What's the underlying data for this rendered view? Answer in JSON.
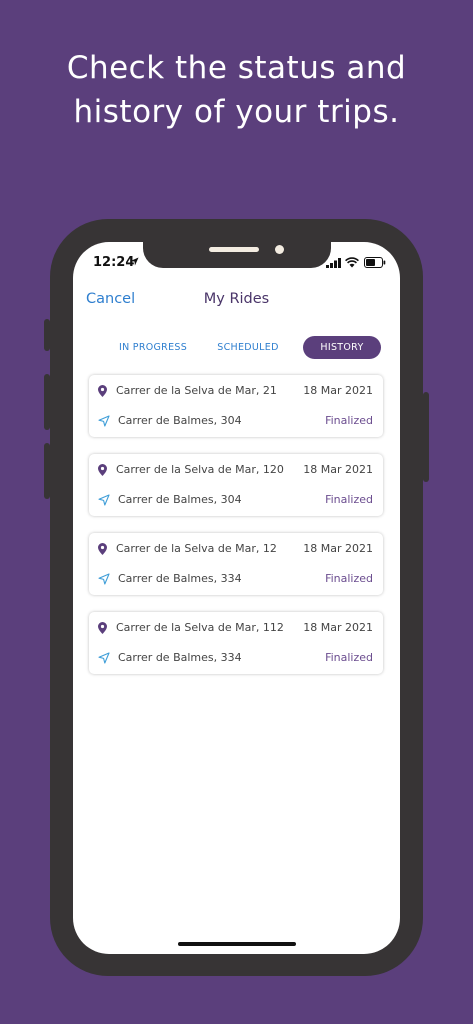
{
  "headline": {
    "line1": "Check the status and",
    "line2": "history of your trips."
  },
  "status_bar": {
    "time": "12:24"
  },
  "nav": {
    "cancel_label": "Cancel",
    "title": "My Rides"
  },
  "tabs": [
    {
      "label": "IN PROGRESS",
      "active": false
    },
    {
      "label": "SCHEDULED",
      "active": false
    },
    {
      "label": "HISTORY",
      "active": true
    }
  ],
  "rides": [
    {
      "origin": "Carrer de la Selva de Mar, 21",
      "date": "18 Mar 2021",
      "destination": "Carrer de Balmes, 304",
      "status": "Finalized"
    },
    {
      "origin": "Carrer de la Selva de Mar, 120",
      "date": "18 Mar 2021",
      "destination": "Carrer de Balmes, 304",
      "status": "Finalized"
    },
    {
      "origin": "Carrer de la Selva de Mar, 12",
      "date": "18 Mar 2021",
      "destination": "Carrer de Balmes, 334",
      "status": "Finalized"
    },
    {
      "origin": "Carrer de la Selva de Mar, 112",
      "date": "18 Mar 2021",
      "destination": "Carrer de Balmes, 334",
      "status": "Finalized"
    }
  ],
  "colors": {
    "background": "#5b3f7c",
    "accent": "#5b3f7c",
    "link": "#2f7fcf",
    "status": "#6b4d8f"
  },
  "icons": {
    "origin": "location-pin-icon",
    "destination": "navigation-arrow-icon"
  }
}
